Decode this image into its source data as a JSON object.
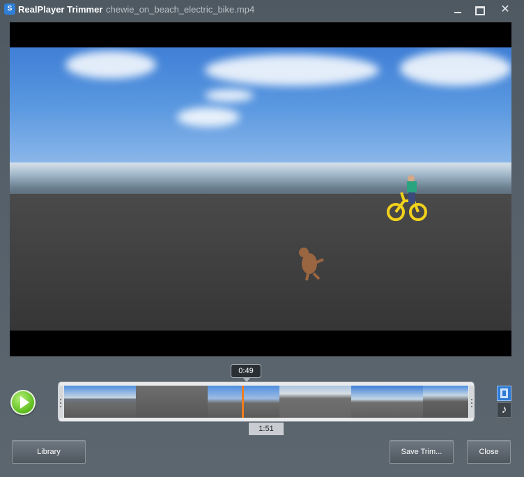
{
  "window": {
    "app_name": "RealPlayer Trimmer",
    "file_name": "chewie_on_beach_electric_bike.mp4"
  },
  "player": {
    "current_time": "0:49",
    "duration": "1:51",
    "play_icon": "play-icon"
  },
  "timeline": {
    "playhead_fraction": 0.44,
    "mode_video_icon": "film-icon",
    "mode_audio_icon": "music-note-icon"
  },
  "buttons": {
    "library": "Library",
    "save_trim": "Save Trim...",
    "close": "Close"
  },
  "colors": {
    "playhead": "#ef7d1e",
    "play_button": "#5fbf1f",
    "active_mode": "#2e7ad6"
  }
}
